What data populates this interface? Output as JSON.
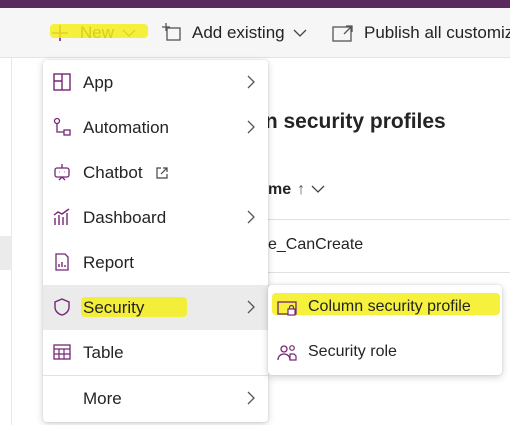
{
  "commandbar": {
    "new_label": "New",
    "add_existing_label": "Add existing",
    "publish_label": "Publish all customiz"
  },
  "page": {
    "title": "nn security profiles",
    "column_header": "me",
    "sort_indicator": "↑",
    "row_value": "e_CanCreate"
  },
  "new_menu": {
    "items": [
      {
        "label": "App",
        "icon": "app-grid-icon",
        "submenu": true
      },
      {
        "label": "Automation",
        "icon": "flow-icon",
        "submenu": true
      },
      {
        "label": "Chatbot",
        "icon": "bot-icon",
        "external": true
      },
      {
        "label": "Dashboard",
        "icon": "chart-icon",
        "submenu": true
      },
      {
        "label": "Report",
        "icon": "report-icon"
      },
      {
        "label": "Security",
        "icon": "shield-icon",
        "submenu": true,
        "active": true
      },
      {
        "label": "Table",
        "icon": "table-icon"
      },
      {
        "label": "More",
        "icon": "",
        "submenu": true
      }
    ]
  },
  "security_submenu": {
    "items": [
      {
        "label": "Column security profile",
        "icon": "column-lock-icon"
      },
      {
        "label": "Security role",
        "icon": "people-role-icon"
      }
    ]
  },
  "colors": {
    "accent_purple": "#742774",
    "header_bar": "#5a2a5f",
    "highlighter": "#f5ee1a"
  }
}
